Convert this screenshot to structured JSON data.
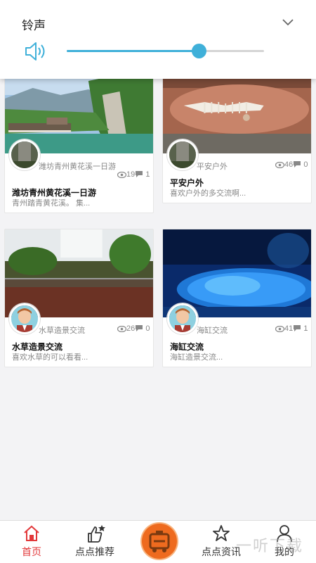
{
  "volume_panel": {
    "title": "铃声",
    "level": 0.67,
    "accent_color": "#3fb0d9",
    "icons": {
      "speaker": "speaker-icon",
      "collapse": "chevron-down-icon"
    }
  },
  "posts": [
    {
      "author": "潍坊青州黄花溪一日游",
      "views": "19",
      "comments": "1",
      "title": "潍坊青州黄花溪一日游",
      "desc": "青州踏青黄花溪。 集..."
    },
    {
      "author": "平安户外",
      "views": "46",
      "comments": "0",
      "title": "平安户外",
      "desc": "喜欢户外的多交流啊..."
    },
    {
      "author": "水草造景交流",
      "views": "26",
      "comments": "0",
      "title": "水草造景交流",
      "desc": "喜欢水草的可以看看..."
    },
    {
      "author": "海缸交流",
      "views": "41",
      "comments": "1",
      "title": "海缸交流",
      "desc": "海缸造景交流..."
    }
  ],
  "bottom_nav": {
    "items": [
      {
        "label": "首页",
        "icon": "home-icon",
        "active": true
      },
      {
        "label": "点点推荐",
        "icon": "thumbs-up-icon",
        "active": false
      },
      {
        "label": "点点资讯",
        "icon": "star-icon",
        "active": false
      },
      {
        "label": "我的",
        "icon": "user-icon",
        "active": false
      }
    ],
    "center_icon": "camera-logo-icon",
    "active_color": "#e2383a"
  },
  "watermark": "一听下载"
}
